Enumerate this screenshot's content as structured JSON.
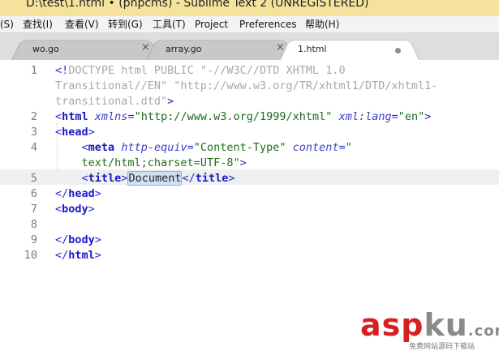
{
  "window": {
    "title": "D:\\test\\1.html • (phpcms) - Sublime Text 2 (UNREGISTERED)"
  },
  "menu": {
    "items": [
      {
        "label": "(S)"
      },
      {
        "label": "查找(I)"
      },
      {
        "label": "查看(V)"
      },
      {
        "label": "转到(G)"
      },
      {
        "label": "工具(T)"
      },
      {
        "label": "Project"
      },
      {
        "label": "Preferences"
      },
      {
        "label": "帮助(H)"
      }
    ]
  },
  "tabs": [
    {
      "label": "wo.go",
      "close": "×",
      "active": false
    },
    {
      "label": "array.go",
      "close": "×",
      "active": false
    },
    {
      "label": "1.html",
      "active": true,
      "modified": true
    }
  ],
  "editor": {
    "line_numbers": [
      "1",
      "2",
      "3",
      "4",
      "5",
      "6",
      "7",
      "8",
      "9",
      "10"
    ],
    "current_line": 5,
    "code": {
      "l1a_open": "<!",
      "l1a_doctype": "DOCTYPE html PUBLIC \"-//W3C//DTD XHTML 1.0",
      "l1b": "Transitional//EN\" \"http://www.w3.org/TR/xhtml1/DTD/xhtml1-",
      "l1c_text": "transitional.dtd\"",
      "l1c_close": ">",
      "l2_open": "<",
      "l2_tag": "html",
      "l2_attr": "xmlns",
      "l2_eq": "=",
      "l2_val": "\"http://www.w3.org/1999/xhtml\"",
      "l2_attr2": "xml:lang",
      "l2_eq2": "=",
      "l2_val2": "\"en\"",
      "l2_close": ">",
      "l3_open": "<",
      "l3_tag": "head",
      "l3_close": ">",
      "l4a_open": "<",
      "l4a_tag": "meta",
      "l4a_attr": "http-equiv",
      "l4a_eq": "=",
      "l4a_val": "\"Content-Type\"",
      "l4a_attr2": "content",
      "l4a_eq2": "=",
      "l4a_val2": "\"",
      "l4b_val": "text/html;charset=UTF-8\"",
      "l4b_close": ">",
      "l5_open": "<",
      "l5_tag": "title",
      "l5_gt": ">",
      "l5_text": "Document",
      "l5_close_open": "</",
      "l5_close_tag": "title",
      "l5_close_gt": ">",
      "l6_open": "</",
      "l6_tag": "head",
      "l6_close": ">",
      "l7_open": "<",
      "l7_tag": "body",
      "l7_close": ">",
      "l9_open": "</",
      "l9_tag": "body",
      "l9_close": ">",
      "l10_open": "</",
      "l10_tag": "html",
      "l10_close": ">"
    }
  },
  "watermark": {
    "brand_red": "asp",
    "brand_gray": "ku",
    "brand_tld": ".com",
    "tagline": "免费网站源码下载站",
    "colors": {
      "red": "#d62020",
      "gray": "#8a8a8a"
    }
  }
}
